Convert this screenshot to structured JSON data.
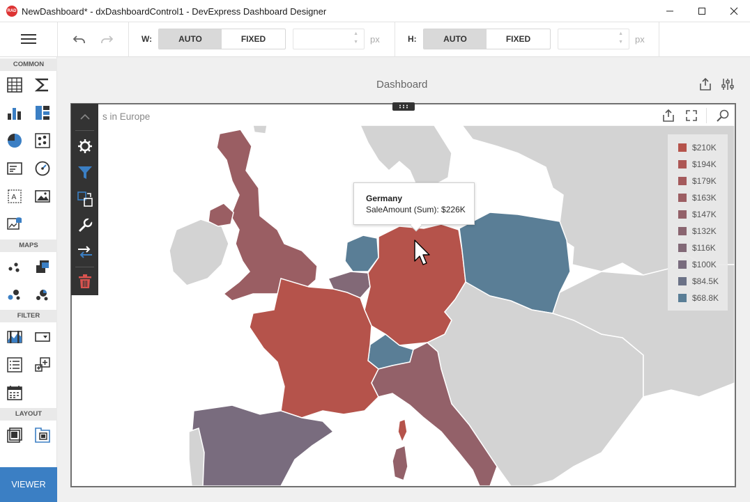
{
  "window": {
    "title": "NewDashboard* - dxDashboardControl1 - DevExpress Dashboard Designer",
    "app_icon": "RAD",
    "minimize_icon": "minimize-icon",
    "maximize_icon": "maximize-icon",
    "close_icon": "close-icon"
  },
  "toolbar": {
    "width_label": "W:",
    "height_label": "H:",
    "auto_label": "AUTO",
    "fixed_label": "FIXED",
    "unit": "px",
    "width_mode": "AUTO",
    "height_mode": "AUTO"
  },
  "sidebar": {
    "sections": [
      "COMMON",
      "MAPS",
      "FILTER",
      "LAYOUT"
    ],
    "viewer_button": "VIEWER"
  },
  "dashboard": {
    "title": "Dashboard",
    "item_title": "s in Europe"
  },
  "legend": [
    {
      "label": "$210K",
      "color": "#b5534b"
    },
    {
      "label": "$194K",
      "color": "#ad5755"
    },
    {
      "label": "$179K",
      "color": "#a45a5c"
    },
    {
      "label": "$163K",
      "color": "#9c5e63"
    },
    {
      "label": "$147K",
      "color": "#936169"
    },
    {
      "label": "$132K",
      "color": "#8a6570"
    },
    {
      "label": "$116K",
      "color": "#826977"
    },
    {
      "label": "$100K",
      "color": "#796c7e"
    },
    {
      "label": "$84.5K",
      "color": "#6b7287"
    },
    {
      "label": "$68.8K",
      "color": "#5a7e96"
    }
  ],
  "tooltip": {
    "country": "Germany",
    "value": "SaleAmount (Sum): $226K"
  },
  "colors": {
    "accent": "#3b7fc4",
    "map_inactive": "#d3d3d3",
    "map_water": "#ffffff"
  }
}
